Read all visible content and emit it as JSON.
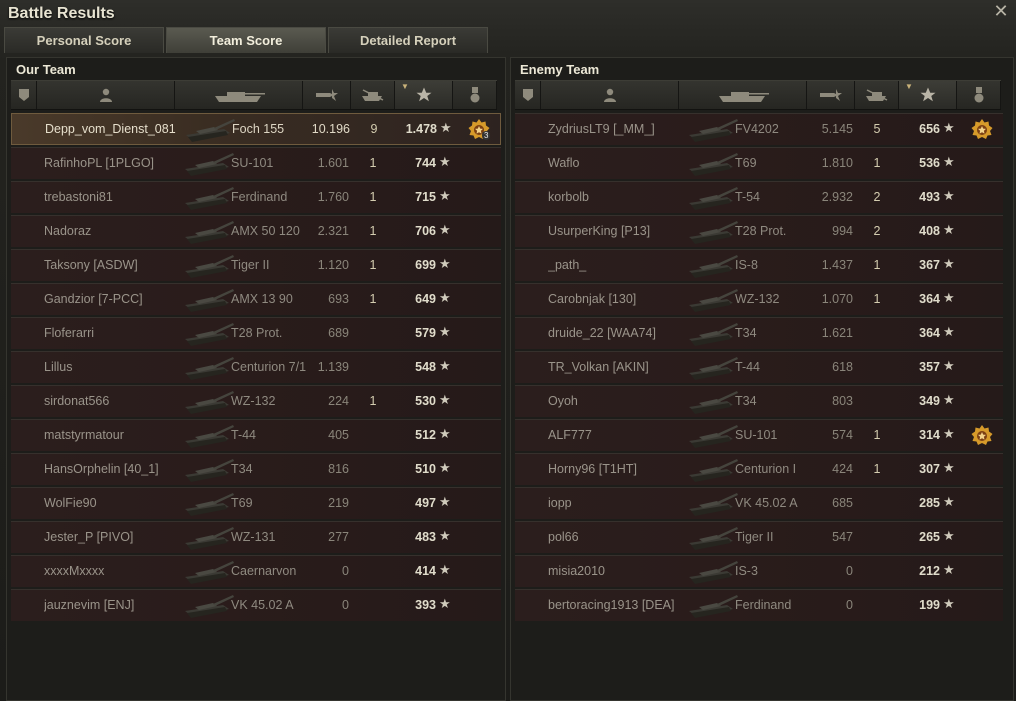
{
  "window": {
    "title": "Battle Results",
    "close_icon": "close-icon"
  },
  "tabs": [
    {
      "label": "Personal Score",
      "active": false
    },
    {
      "label": "Team Score",
      "active": true
    },
    {
      "label": "Detailed Report",
      "active": false
    }
  ],
  "columns": {
    "icons": [
      "squad-icon",
      "player-icon",
      "tank-icon",
      "damage-icon",
      "kills-icon",
      "xp-star-icon",
      "medal-icon"
    ],
    "sorted_by": "xp"
  },
  "our_team": {
    "title": "Our Team",
    "rows": [
      {
        "player": "Depp_vom_Dienst_081",
        "vehicle": "Foch 155",
        "damage": "10.196",
        "kills": "9",
        "xp": "1.478",
        "medal": true,
        "medal_count": "3",
        "me": true
      },
      {
        "player": "RafinhoPL [1PLGO]",
        "vehicle": "SU-101",
        "damage": "1.601",
        "kills": "1",
        "xp": "744"
      },
      {
        "player": "trebastoni81",
        "vehicle": "Ferdinand",
        "damage": "1.760",
        "kills": "1",
        "xp": "715"
      },
      {
        "player": "Nadoraz",
        "vehicle": "AMX 50 120",
        "damage": "2.321",
        "kills": "1",
        "xp": "706"
      },
      {
        "player": "Taksony [ASDW]",
        "vehicle": "Tiger II",
        "damage": "1.120",
        "kills": "1",
        "xp": "699"
      },
      {
        "player": "Gandzior [7-PCC]",
        "vehicle": "AMX 13 90",
        "damage": "693",
        "kills": "1",
        "xp": "649"
      },
      {
        "player": "Floferarri",
        "vehicle": "T28 Prot.",
        "damage": "689",
        "kills": "",
        "xp": "579"
      },
      {
        "player": "Lillus",
        "vehicle": "Centurion 7/1",
        "damage": "1.139",
        "kills": "",
        "xp": "548"
      },
      {
        "player": "sirdonat566",
        "vehicle": "WZ-132",
        "damage": "224",
        "kills": "1",
        "xp": "530"
      },
      {
        "player": "matstyrmatour",
        "vehicle": "T-44",
        "damage": "405",
        "kills": "",
        "xp": "512"
      },
      {
        "player": "HansOrphelin [40_1]",
        "vehicle": "T34",
        "damage": "816",
        "kills": "",
        "xp": "510"
      },
      {
        "player": "WolFie90",
        "vehicle": "T69",
        "damage": "219",
        "kills": "",
        "xp": "497"
      },
      {
        "player": "Jester_P [PIVO]",
        "vehicle": "WZ-131",
        "damage": "277",
        "kills": "",
        "xp": "483"
      },
      {
        "player": "xxxxMxxxx",
        "vehicle": "Caernarvon",
        "damage": "0",
        "kills": "",
        "xp": "414"
      },
      {
        "player": "jauznevim [ENJ]",
        "vehicle": "VK 45.02 A",
        "damage": "0",
        "kills": "",
        "xp": "393"
      }
    ]
  },
  "enemy_team": {
    "title": "Enemy Team",
    "rows": [
      {
        "player": "ZydriusLT9 [_MM_]",
        "vehicle": "FV4202",
        "damage": "5.145",
        "kills": "5",
        "xp": "656",
        "medal": true
      },
      {
        "player": "Waflo",
        "vehicle": "T69",
        "damage": "1.810",
        "kills": "1",
        "xp": "536"
      },
      {
        "player": "korbolb",
        "vehicle": "T-54",
        "damage": "2.932",
        "kills": "2",
        "xp": "493"
      },
      {
        "player": "UsurperKing [P13]",
        "vehicle": "T28 Prot.",
        "damage": "994",
        "kills": "2",
        "xp": "408"
      },
      {
        "player": "_path_",
        "vehicle": "IS-8",
        "damage": "1.437",
        "kills": "1",
        "xp": "367"
      },
      {
        "player": "Carobnjak [130]",
        "vehicle": "WZ-132",
        "damage": "1.070",
        "kills": "1",
        "xp": "364"
      },
      {
        "player": "druide_22 [WAA74]",
        "vehicle": "T34",
        "damage": "1.621",
        "kills": "",
        "xp": "364"
      },
      {
        "player": "TR_Volkan [AKIN]",
        "vehicle": "T-44",
        "damage": "618",
        "kills": "",
        "xp": "357"
      },
      {
        "player": "Oyoh",
        "vehicle": "T34",
        "damage": "803",
        "kills": "",
        "xp": "349"
      },
      {
        "player": "ALF777",
        "vehicle": "SU-101",
        "damage": "574",
        "kills": "1",
        "xp": "314",
        "medal": true
      },
      {
        "player": "Horny96 [T1HT]",
        "vehicle": "Centurion I",
        "damage": "424",
        "kills": "1",
        "xp": "307"
      },
      {
        "player": "iopp",
        "vehicle": "VK 45.02 A",
        "damage": "685",
        "kills": "",
        "xp": "285"
      },
      {
        "player": "pol66",
        "vehicle": "Tiger II",
        "damage": "547",
        "kills": "",
        "xp": "265"
      },
      {
        "player": "misia2010",
        "vehicle": "IS-3",
        "damage": "0",
        "kills": "",
        "xp": "212"
      },
      {
        "player": "bertoracing1913 [DEA]",
        "vehicle": "Ferdinand",
        "damage": "0",
        "kills": "",
        "xp": "199"
      }
    ]
  }
}
